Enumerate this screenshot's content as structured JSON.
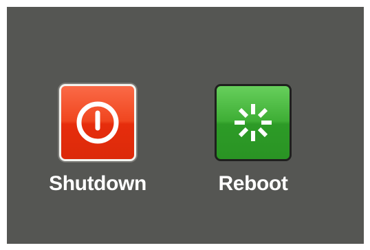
{
  "menu": {
    "options": [
      {
        "id": "shutdown",
        "label": "Shutdown",
        "icon": "power-icon",
        "color": "#e9320f"
      },
      {
        "id": "reboot",
        "label": "Reboot",
        "icon": "spinner-icon",
        "color": "#38a830"
      }
    ]
  },
  "colors": {
    "background": "#555653",
    "selection_border": "#f4f4f0"
  }
}
